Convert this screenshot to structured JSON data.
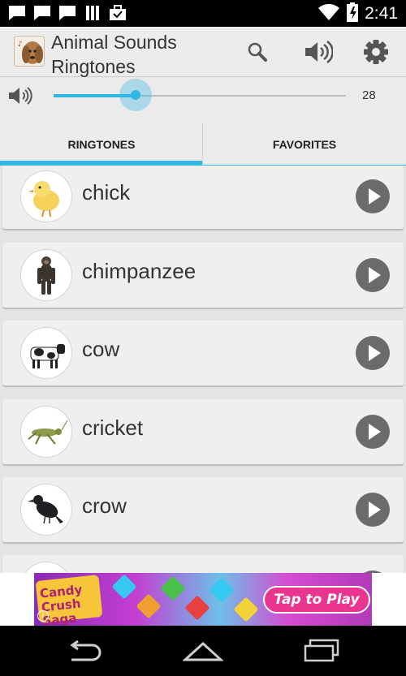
{
  "status_bar": {
    "time": "2:41",
    "notification_icons": [
      "message-icon",
      "message-icon",
      "message-icon",
      "sim-cards-icon",
      "briefcase-icon"
    ],
    "system_icons": [
      "wifi-icon",
      "battery-charging-icon"
    ]
  },
  "action_bar": {
    "title": "Animal Sounds Ringtones",
    "icons": [
      "app-logo-icon",
      "search-icon",
      "volume-icon",
      "settings-gear-icon"
    ]
  },
  "volume": {
    "level": 28,
    "level_display": "28",
    "slider_fraction": 0.28,
    "icon": "speaker-icon"
  },
  "tabs": [
    {
      "label": "RINGTONES",
      "active": true
    },
    {
      "label": "FAVORITES",
      "active": false
    }
  ],
  "ringtones": [
    {
      "label": "chick",
      "icon": "chick-icon"
    },
    {
      "label": "chimpanzee",
      "icon": "chimpanzee-icon"
    },
    {
      "label": "cow",
      "icon": "cow-icon"
    },
    {
      "label": "cricket",
      "icon": "cricket-icon"
    },
    {
      "label": "crow",
      "icon": "crow-icon"
    },
    {
      "label": "",
      "icon": "partial-animal-icon"
    }
  ],
  "ad": {
    "brand": "Candy Crush Saga",
    "cta": "Tap to Play",
    "info": "i"
  },
  "nav_bar": {
    "icons": [
      "back-icon",
      "home-icon",
      "recent-apps-icon"
    ]
  },
  "colors": {
    "accent": "#33b5e5",
    "play_button": "#6b6b6b",
    "ad_cta": "#e93590"
  }
}
